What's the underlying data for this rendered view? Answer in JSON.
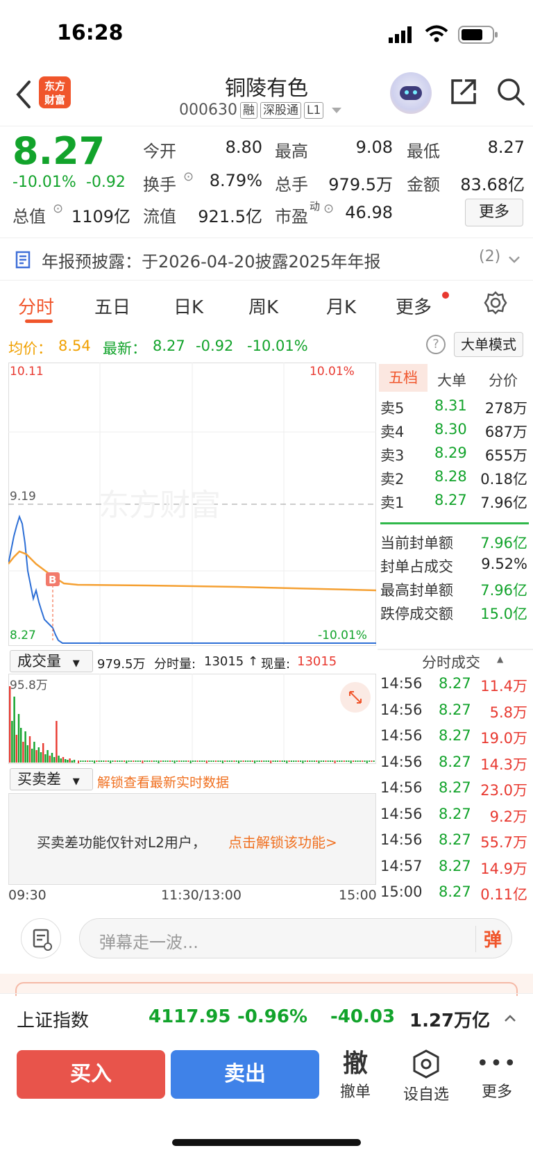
{
  "status": {
    "time": "16:28"
  },
  "header": {
    "logo_text": "东方\n财富",
    "name": "铜陵有色",
    "code": "000630",
    "tags": [
      "融",
      "深股通",
      "L1"
    ]
  },
  "quote": {
    "price": "8.27",
    "pct": "-10.01%",
    "chg": "-0.92",
    "open_label": "今开",
    "open": "8.80",
    "high_label": "最高",
    "high": "9.08",
    "low_label": "最低",
    "low": "8.27",
    "turnover_label": "换手",
    "turnover": "8.79%",
    "volume_label": "总手",
    "volume": "979.5万",
    "amount_label": "金额",
    "amount": "83.68亿",
    "mktcap_label": "总值",
    "mktcap": "1109亿",
    "float_label": "流值",
    "float": "921.5亿",
    "pe_label": "市盈",
    "pe_sup": "动",
    "pe": "46.98",
    "more": "更多"
  },
  "notice": {
    "text": "年报预披露：于2026-04-20披露2025年年报",
    "count": "(2)"
  },
  "tabs": [
    "分时",
    "五日",
    "日K",
    "周K",
    "月K",
    "更多"
  ],
  "infobar": {
    "avg_label": "均价：",
    "avg": "8.54",
    "latest_label": "最新：",
    "latest": "8.27",
    "latest_chg": "-0.92",
    "latest_pct": "-10.01%",
    "big_order_mode": "大单模式"
  },
  "chart_labels": {
    "top_price": "10.11",
    "top_pct": "10.01%",
    "mid_price": "9.19",
    "bottom_price": "8.27",
    "bottom_pct": "-10.01%",
    "watermark": "东方财富",
    "marker": "B"
  },
  "volume_bar": {
    "selector": "成交量",
    "total": "979.5万",
    "ts_label": "分时量:",
    "ts_val": "13015 ↑",
    "now_label": "现量:",
    "now_val": "13015",
    "max": "95.8万"
  },
  "diff_bar": {
    "selector": "买卖差",
    "unlock": "解锁查看最新实时数据",
    "desc": "买卖差功能仅针对L2用户，",
    "link": "点击解锁该功能>"
  },
  "time_axis": {
    "start": "09:30",
    "mid": "11:30/13:00",
    "end": "15:00"
  },
  "orderbook": {
    "tabs": [
      "五档",
      "大单",
      "分价"
    ],
    "asks": [
      {
        "label": "卖5",
        "price": "8.31",
        "vol": "278万"
      },
      {
        "label": "卖4",
        "price": "8.30",
        "vol": "687万"
      },
      {
        "label": "卖3",
        "price": "8.29",
        "vol": "655万"
      },
      {
        "label": "卖2",
        "price": "8.28",
        "vol": "0.18亿"
      },
      {
        "label": "卖1",
        "price": "8.27",
        "vol": "7.96亿"
      }
    ],
    "stats": [
      {
        "label": "当前封单额",
        "val": "7.96亿"
      },
      {
        "label": "封单占成交",
        "val": "9.52%"
      },
      {
        "label": "最高封单额",
        "val": "7.96亿"
      },
      {
        "label": "跌停成交额",
        "val": "15.0亿"
      }
    ],
    "ticks_title": "分时成交",
    "ticks": [
      {
        "t": "14:56",
        "p": "8.27",
        "v": "11.4万"
      },
      {
        "t": "14:56",
        "p": "8.27",
        "v": "5.8万"
      },
      {
        "t": "14:56",
        "p": "8.27",
        "v": "19.0万"
      },
      {
        "t": "14:56",
        "p": "8.27",
        "v": "14.3万"
      },
      {
        "t": "14:56",
        "p": "8.27",
        "v": "23.0万"
      },
      {
        "t": "14:56",
        "p": "8.27",
        "v": "9.2万"
      },
      {
        "t": "14:56",
        "p": "8.27",
        "v": "55.7万"
      },
      {
        "t": "14:57",
        "p": "8.27",
        "v": "14.9万"
      },
      {
        "t": "15:00",
        "p": "8.27",
        "v": "0.11亿"
      }
    ]
  },
  "comment": {
    "placeholder": "弹幕走一波...",
    "danmu": "弹"
  },
  "index_bar": {
    "name": "上证指数",
    "value": "4117.95",
    "pct": "-0.96%",
    "chg": "-40.03",
    "amount": "1.27万亿"
  },
  "actions": {
    "buy": "买入",
    "sell": "卖出",
    "cancel_icon": "撤",
    "cancel": "撤单",
    "fav": "设自选",
    "more": "更多"
  }
}
